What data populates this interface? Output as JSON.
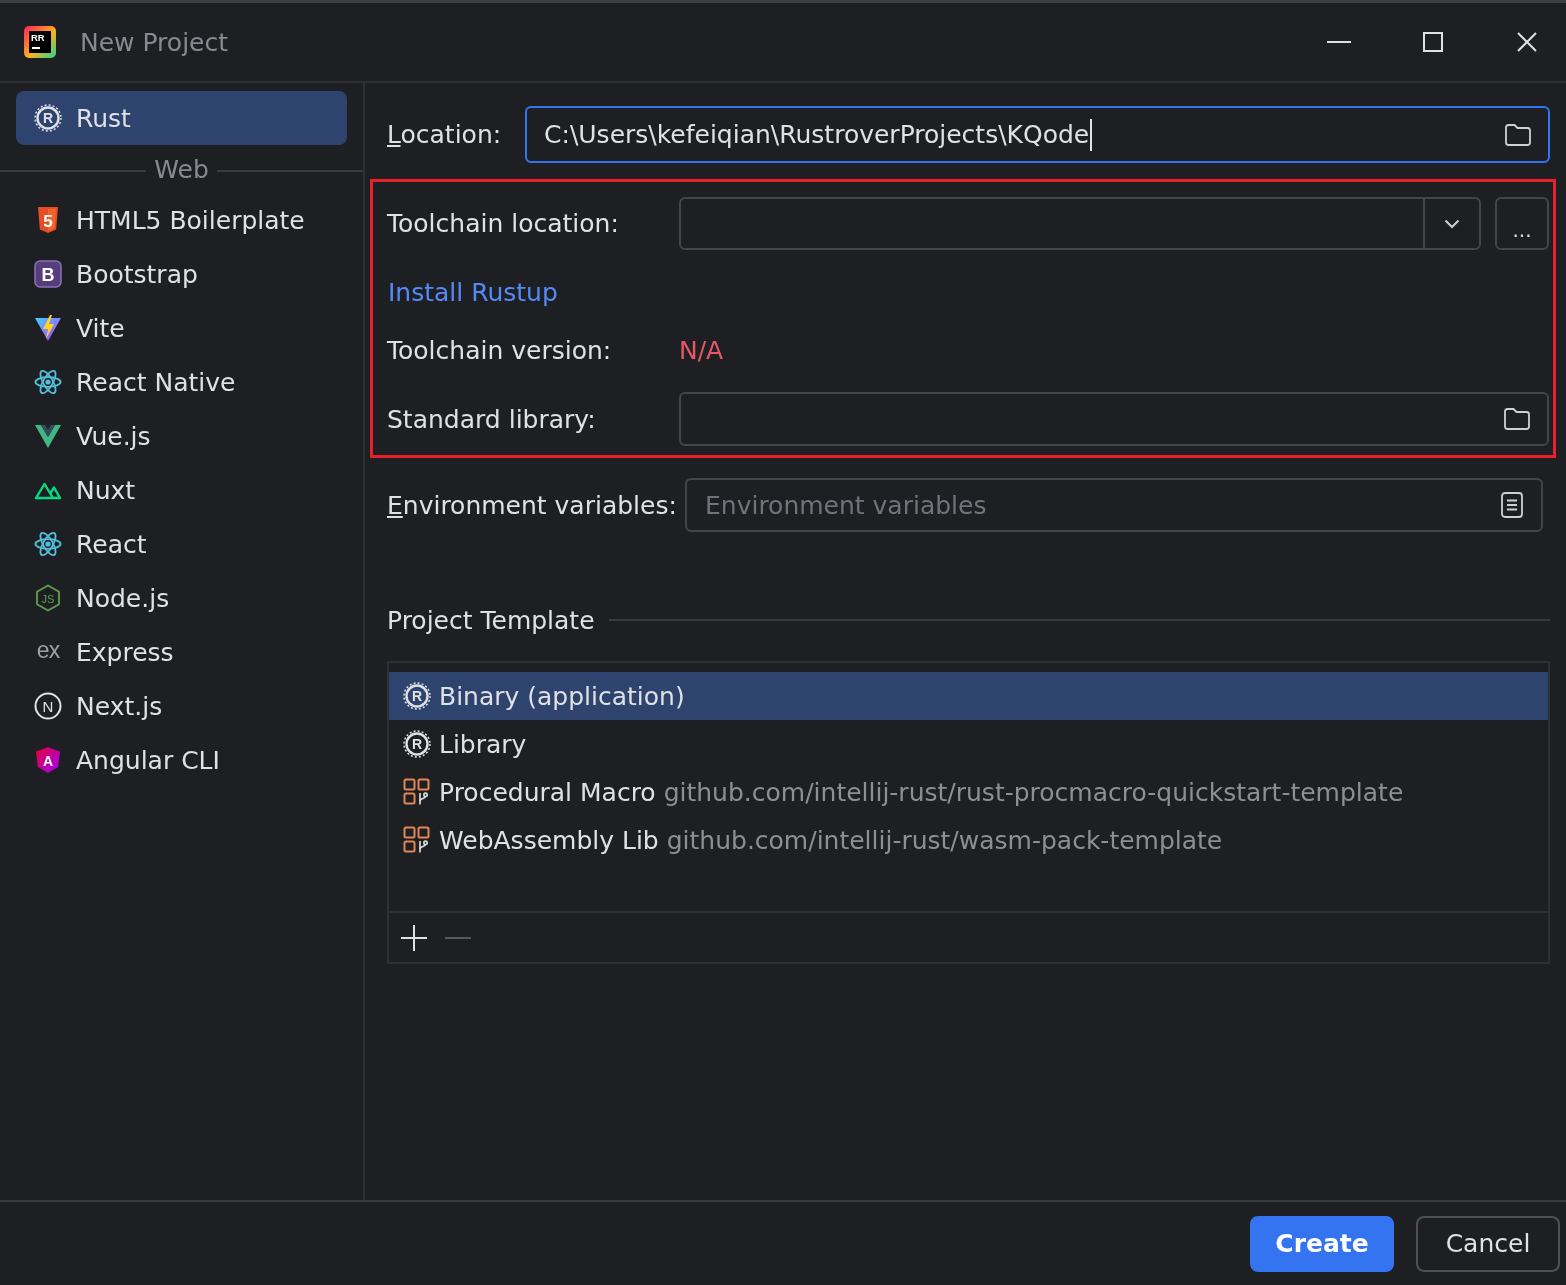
{
  "window": {
    "title": "New Project",
    "app_icon_text": "RR"
  },
  "sidebar": {
    "items": [
      {
        "label": "Rust",
        "kind": "rust",
        "icon_text": "R",
        "selected": true
      }
    ],
    "groups": [
      {
        "title": "Web",
        "items": [
          {
            "label": "HTML5 Boilerplate",
            "kind": "html5",
            "icon_text": "5",
            "selected": false
          },
          {
            "label": "Bootstrap",
            "kind": "bootstrap",
            "icon_text": "B",
            "selected": false
          },
          {
            "label": "Vite",
            "kind": "vite",
            "selected": false
          },
          {
            "label": "React Native",
            "kind": "react",
            "selected": false
          },
          {
            "label": "Vue.js",
            "kind": "vue",
            "selected": false
          },
          {
            "label": "Nuxt",
            "kind": "nuxt",
            "selected": false
          },
          {
            "label": "React",
            "kind": "react",
            "selected": false
          },
          {
            "label": "Node.js",
            "kind": "node",
            "icon_text": "JS",
            "selected": false
          },
          {
            "label": "Express",
            "kind": "express",
            "icon_text": "ex",
            "selected": false
          },
          {
            "label": "Next.js",
            "kind": "next",
            "icon_text": "N",
            "selected": false
          },
          {
            "label": "Angular CLI",
            "kind": "angular",
            "icon_text": "A",
            "selected": false
          }
        ]
      }
    ]
  },
  "location": {
    "label": "Location:",
    "mnemonic": true,
    "value": "C:\\Users\\kefeiqian\\RustroverProjects\\KQode",
    "focused": true
  },
  "toolchain": {
    "highlighted": true,
    "location_label": "Toolchain location:",
    "browse_button": "...",
    "install_link": "Install Rustup",
    "version_label": "Toolchain version:",
    "version_value": "N/A",
    "version_error": true,
    "stdlib_label": "Standard library:"
  },
  "environment": {
    "label": "Environment variables:",
    "mnemonic": true,
    "placeholder": "Environment variables"
  },
  "project_template": {
    "title": "Project Template",
    "templates": [
      {
        "kind": "rust",
        "icon_text": "R",
        "name": "Binary (application)",
        "selected": true
      },
      {
        "kind": "rust",
        "icon_text": "R",
        "name": "Library",
        "selected": false
      },
      {
        "kind": "git",
        "name": "Procedural Macro",
        "url": "github.com/intellij-rust/rust-procmacro-quickstart-template",
        "selected": false
      },
      {
        "kind": "git",
        "name": "WebAssembly Lib",
        "url": "github.com/intellij-rust/wasm-pack-template",
        "selected": false
      }
    ],
    "add_disabled": false,
    "remove_disabled": true
  },
  "buttons": [
    {
      "label": "Create",
      "primary": true
    },
    {
      "label": "Cancel",
      "primary": false
    }
  ]
}
